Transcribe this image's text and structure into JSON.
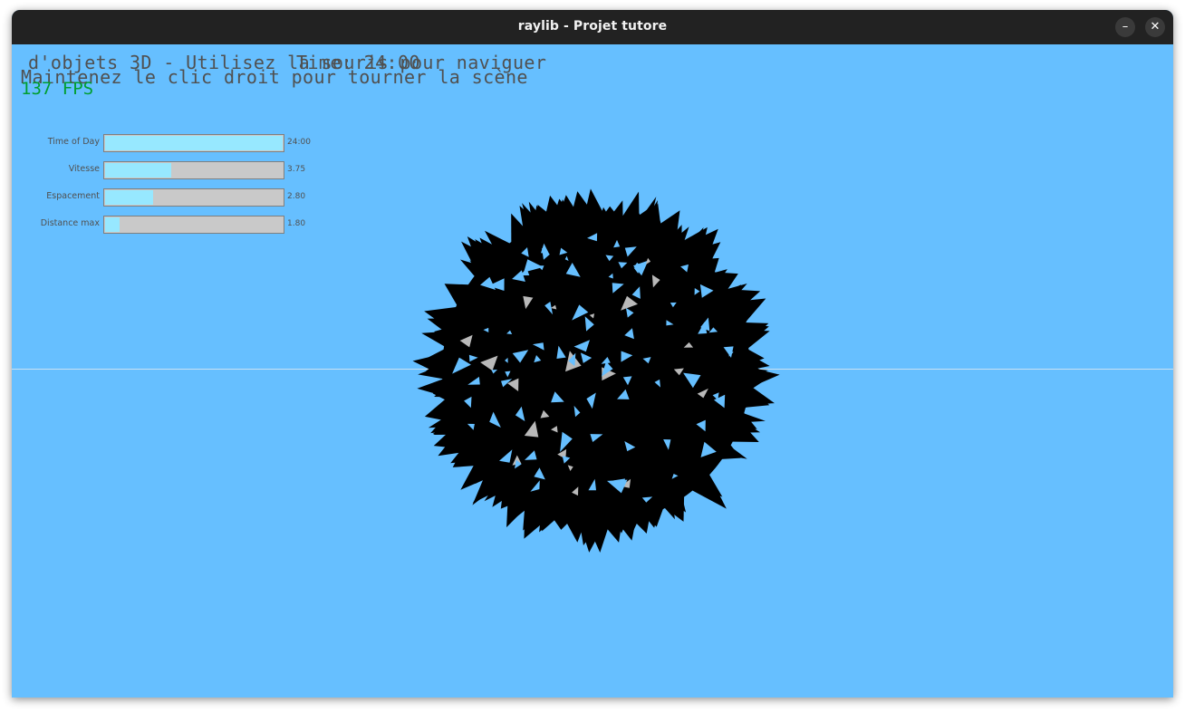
{
  "window": {
    "title": "raylib - Projet tutore",
    "minimize_symbol": "–",
    "close_symbol": "✕"
  },
  "hud": {
    "line1": "d'objets 3D - Utilisez la souris pour naviguer",
    "time_overlay": "Time: 24:00",
    "line2": "Maintenez le clic droit pour tourner la scène",
    "fps": "137 FPS"
  },
  "sliders": [
    {
      "label": "Time of Day",
      "value_text": "24:00",
      "fraction": 1.0
    },
    {
      "label": "Vitesse",
      "value_text": "3.75",
      "fraction": 0.37
    },
    {
      "label": "Espacement",
      "value_text": "2.80",
      "fraction": 0.27
    },
    {
      "label": "Distance max",
      "value_text": "1.80",
      "fraction": 0.08
    }
  ],
  "colors": {
    "sky": "#66bfff",
    "slider_fill": "#97e8ff",
    "slider_track": "#c9c9c9",
    "fps_text": "#009e2f",
    "object": "#000000"
  }
}
